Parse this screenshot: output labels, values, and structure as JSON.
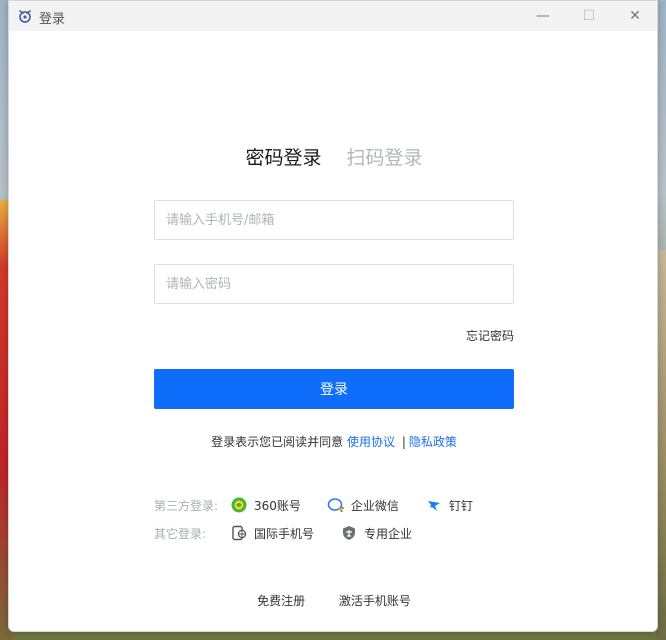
{
  "window": {
    "title": "登录",
    "controls": {
      "minimize": "—",
      "maximize": "☐",
      "close": "✕"
    }
  },
  "tabs": [
    {
      "label": "密码登录",
      "active": true
    },
    {
      "label": "扫码登录",
      "active": false
    }
  ],
  "form": {
    "phone_placeholder": "请输入手机号/邮箱",
    "password_placeholder": "请输入密码",
    "forgot_label": "忘记密码",
    "login_label": "登录"
  },
  "agreement": {
    "prefix": "登录表示您已阅读并同意",
    "terms": "使用协议",
    "separator": "|",
    "privacy": "隐私政策"
  },
  "third_party": {
    "label": "第三方登录:",
    "options": [
      {
        "label": "360账号",
        "icon": "360-icon"
      },
      {
        "label": "企业微信",
        "icon": "wecom-icon"
      },
      {
        "label": "钉钉",
        "icon": "dingtalk-icon"
      }
    ]
  },
  "other_login": {
    "label": "其它登录:",
    "options": [
      {
        "label": "国际手机号",
        "icon": "intl-phone-icon"
      },
      {
        "label": "专用企业",
        "icon": "enterprise-shield-icon"
      }
    ]
  },
  "footer": {
    "register": "免费注册",
    "activate": "激活手机账号"
  },
  "colors": {
    "primary": "#0f6dfc",
    "link": "#1f6ff2",
    "muted": "#a8adb5"
  }
}
